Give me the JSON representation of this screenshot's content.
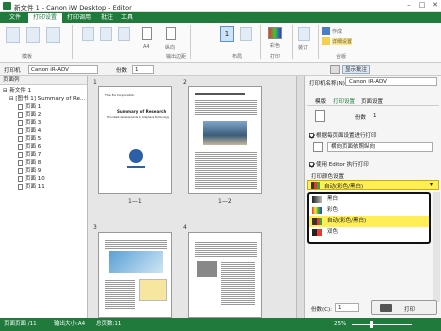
{
  "window": {
    "title": "新文件 1 - Canon iW Desktop - Editor",
    "minimize": "–",
    "maximize": "□",
    "close": "✕"
  },
  "menu_tabs": [
    "文件",
    "打印设置",
    "打印调用",
    "批注",
    "工具"
  ],
  "ribbon": {
    "g1_label": "模板",
    "g2_label": "输出边距",
    "size_label": "A4",
    "orient_label": "纵向",
    "g3_label": "布局",
    "copies_value": "1",
    "g4_label": "打印",
    "color_label": "彩色",
    "g5_label": "装订",
    "g6_label": "合版",
    "preview_label1": "作成",
    "preview_label2": "详细设置"
  },
  "toolbar": {
    "printer_label": "打印机",
    "printer_value": "Canon iR-ADV",
    "copies_label": "份数",
    "copies_value": "1",
    "right_btn": "显示批注"
  },
  "tree": {
    "header": "页面列",
    "items": [
      "新文件 1",
      "[图书 1] Summary of Re...",
      "页面 1",
      "页面 2",
      "页面 3",
      "页面 4",
      "页面 5",
      "页面 6",
      "页面 7",
      "页面 8",
      "页面 9",
      "页面 10",
      "页面 11"
    ]
  },
  "pages": {
    "p1_num": "1",
    "p2_num": "2",
    "p3_num": "3",
    "p4_num": "4",
    "label_1_1": "1—1",
    "label_1_2": "1—2",
    "p1_company": "The 3G Corporation",
    "p1_title": "Summary of Research",
    "p1_sub": "The latest developments in Graphene Technology"
  },
  "right_panel": {
    "printer_label": "打印机名称(N)",
    "printer_value": "Canon iR-ADV",
    "tab1": "模版",
    "tab2": "打印设置",
    "tab3": "页面设置",
    "copies_hint": "份数",
    "copies_value": "1",
    "check1": "根据每页面设置进行打印",
    "select1": "横向页面依照纵向",
    "check2": "使用 Editor 执行打印",
    "section": "打印颜色设置",
    "color_selected": "自动(彩色/黑白)",
    "dropdown": [
      "黑白",
      "彩色",
      "自动(彩色/黑白)",
      "双色"
    ],
    "footer_copies_label": "份数(C):",
    "footer_copies_value": "1",
    "print_button": "打印"
  },
  "status": {
    "left": "页面页面 /11",
    "mid": "输出大小:A4",
    "right": "总页数:11",
    "zoom": "25%"
  },
  "colors": {
    "accent": "#1f7a3c",
    "highlight": "#ffee55"
  }
}
